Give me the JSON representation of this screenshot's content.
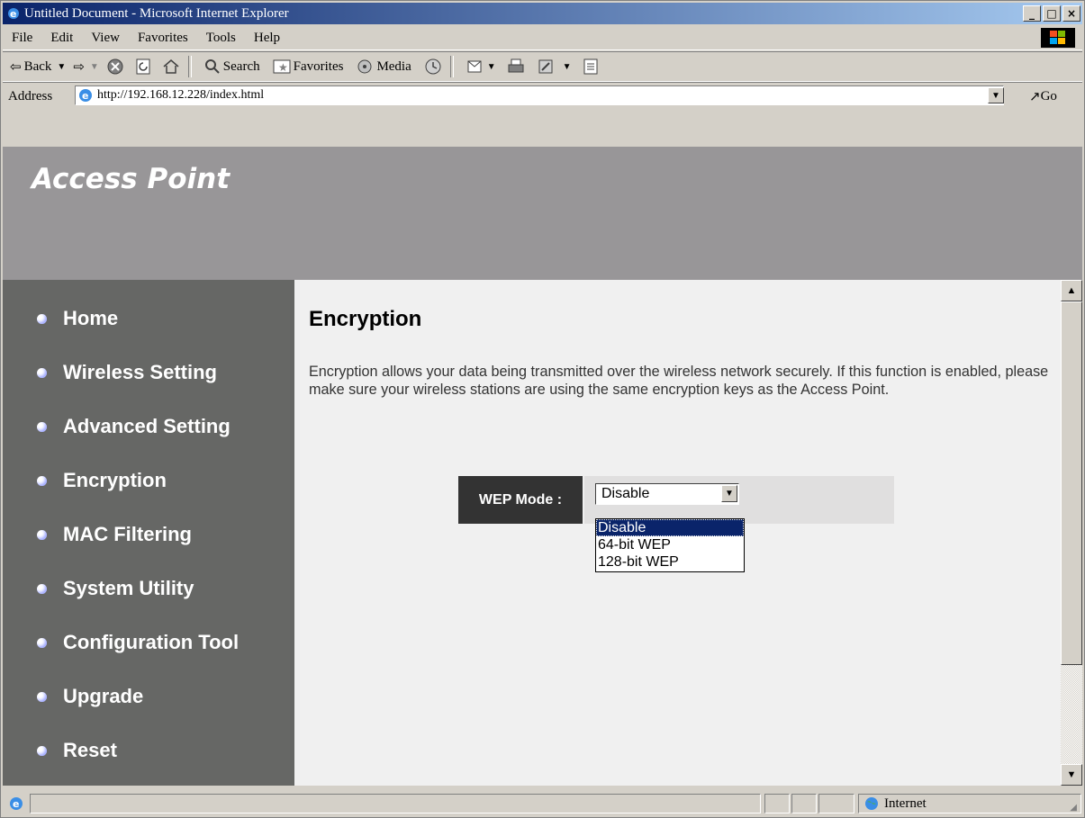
{
  "window": {
    "title": "Untitled Document - Microsoft Internet Explorer"
  },
  "menu": [
    "File",
    "Edit",
    "View",
    "Favorites",
    "Tools",
    "Help"
  ],
  "toolbar": {
    "back": "Back",
    "search": "Search",
    "favorites": "Favorites",
    "media": "Media"
  },
  "address": {
    "label": "Address",
    "url": "http://192.168.12.228/index.html",
    "go": "Go"
  },
  "page": {
    "brand": "Access Point",
    "nav": [
      "Home",
      "Wireless Setting",
      "Advanced Setting",
      "Encryption",
      "MAC Filtering",
      "System Utility",
      "Configuration Tool",
      "Upgrade",
      "Reset"
    ],
    "heading": "Encryption",
    "description": "Encryption allows your data being transmitted over the wireless network securely. If this function is enabled, please make sure your wireless stations are using the same encryption keys as the Access Point.",
    "wep_label": "WEP Mode :",
    "wep_value": "Disable",
    "wep_options": [
      "Disable",
      "64-bit WEP",
      "128-bit WEP"
    ]
  },
  "status": {
    "zone": "Internet"
  }
}
